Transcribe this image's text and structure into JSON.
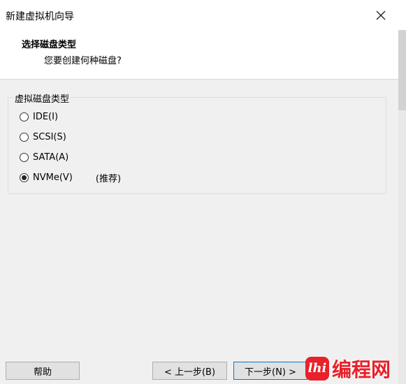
{
  "window": {
    "title": "新建虚拟机向导",
    "close_symbol": "✕"
  },
  "header": {
    "title": "选择磁盘类型",
    "subtitle": "您要创建何种磁盘?"
  },
  "disk_type": {
    "group_label": "虚拟磁盘类型",
    "options": [
      {
        "label": "IDE(I)",
        "checked": false
      },
      {
        "label": "SCSI(S)",
        "checked": false
      },
      {
        "label": "SATA(A)",
        "checked": false
      },
      {
        "label": "NVMe(V)",
        "checked": true,
        "note": "(推荐)"
      }
    ]
  },
  "footer": {
    "help_label": "帮助",
    "back_label": "< 上一步(B)",
    "next_label": "下一步(N) >"
  },
  "watermark": {
    "logo_text": "lhi",
    "text": "编程网",
    "color": "#e8212a"
  },
  "icons": {
    "close": "close-icon",
    "radio": "radio-icon"
  }
}
